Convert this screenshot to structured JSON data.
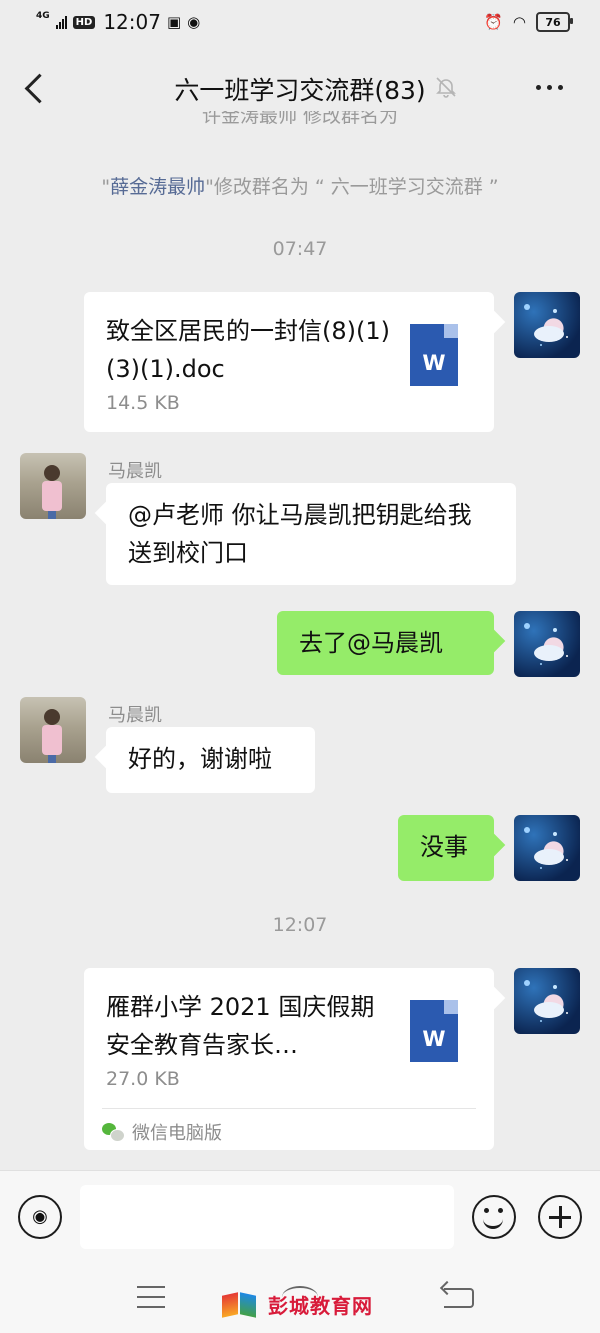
{
  "status_bar": {
    "network": "4G",
    "hd": "HD",
    "time": "12:07",
    "battery": "76"
  },
  "header": {
    "title": "六一班学习交流群(83)"
  },
  "system_messages": [
    {
      "text_before": "\"",
      "name": "薛金涛最帅",
      "text_after": "\"修改群名为 “ 六一班学习交流群 ”"
    }
  ],
  "cut_system_text": "许金涛最帅 修改群名为",
  "timestamps": [
    "07:47",
    "12:07"
  ],
  "messages": [
    {
      "type": "file",
      "file_name": "致全区居民的一封信(8)(1)(3)(1).doc",
      "file_size": "14.5 KB",
      "icon_letter": "W"
    },
    {
      "type": "text",
      "sender": "马晨凯",
      "text": "@卢老师  你让马晨凯把钥匙给我送到校门口"
    },
    {
      "type": "text",
      "text": "去了@马晨凯"
    },
    {
      "type": "text",
      "sender": "马晨凯",
      "text": "好的，谢谢啦"
    },
    {
      "type": "text",
      "text": "没事"
    },
    {
      "type": "file",
      "file_name": "雁群小学 2021 国庆假期安全教育告家长…",
      "file_size": "27.0 KB",
      "icon_letter": "W",
      "source": "微信电脑版"
    }
  ],
  "watermark": "彭城教育网",
  "colors": {
    "background": "#ededed",
    "my_bubble": "#95ec69",
    "link_name": "#576b95",
    "word_icon": "#2b5ab0"
  }
}
